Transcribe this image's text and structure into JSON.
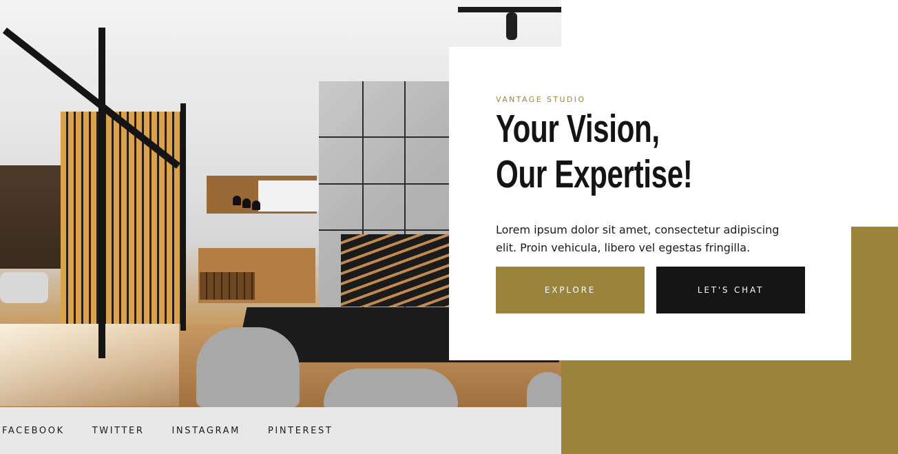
{
  "hero": {
    "image_alt": "Modern interior with glass walls, wooden slats, kitchen, concrete staircase and dark dining table"
  },
  "card": {
    "eyebrow": "VANTAGE STUDIO",
    "headline": "Your Vision, Our Expertise!",
    "body": "Lorem ipsum dolor sit amet, consectetur adipiscing elit. Proin vehicula, libero vel egestas fringilla.",
    "buttons": {
      "explore": "EXPLORE",
      "chat": "LET'S CHAT"
    }
  },
  "social": {
    "links": [
      "FACEBOOK",
      "TWITTER",
      "INSTAGRAM",
      "PINTEREST"
    ]
  },
  "colors": {
    "accent_gold": "#9a843c",
    "dark": "#151515",
    "social_bar_bg": "#e8e8e8"
  }
}
